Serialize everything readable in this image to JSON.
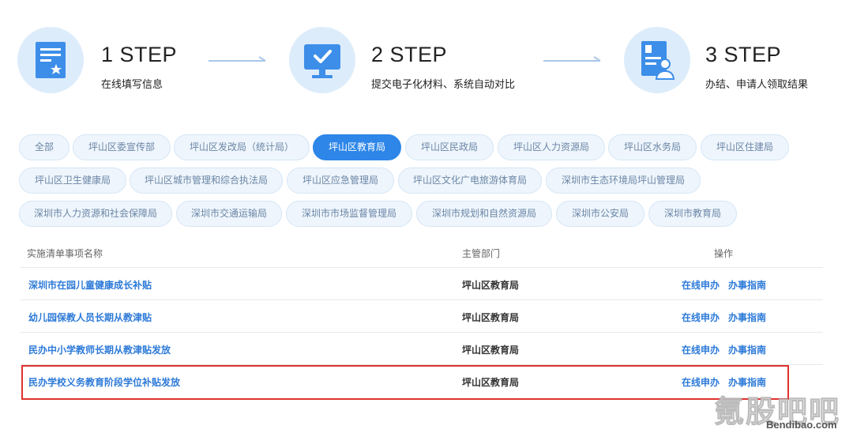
{
  "steps": [
    {
      "number": "1 STEP",
      "desc": "在线填写信息"
    },
    {
      "number": "2 STEP",
      "desc": "提交电子化材料、系统自动对比"
    },
    {
      "number": "3 STEP",
      "desc": "办结、申请人领取结果"
    }
  ],
  "tags": [
    {
      "label": "全部"
    },
    {
      "label": "坪山区委宣传部"
    },
    {
      "label": "坪山区发改局（统计局）"
    },
    {
      "label": "坪山区教育局"
    },
    {
      "label": "坪山区民政局"
    },
    {
      "label": "坪山区人力资源局"
    },
    {
      "label": "坪山区水务局"
    },
    {
      "label": "坪山区住建局"
    },
    {
      "label": "坪山区卫生健康局"
    },
    {
      "label": "坪山区城市管理和综合执法局"
    },
    {
      "label": "坪山区应急管理局"
    },
    {
      "label": "坪山区文化广电旅游体育局"
    },
    {
      "label": "深圳市生态环境局坪山管理局"
    },
    {
      "label": "深圳市人力资源和社会保障局"
    },
    {
      "label": "深圳市交通运输局"
    },
    {
      "label": "深圳市市场监督管理局"
    },
    {
      "label": "深圳市规划和自然资源局"
    },
    {
      "label": "深圳市公安局"
    },
    {
      "label": "深圳市教育局"
    }
  ],
  "table": {
    "headers": {
      "name": "实施清单事项名称",
      "dept": "主管部门",
      "ops": "操作"
    },
    "rows": [
      {
        "name": "深圳市在园儿童健康成长补贴",
        "dept": "坪山区教育局",
        "op1": "在线申办",
        "op2": "办事指南"
      },
      {
        "name": "幼儿园保教人员长期从教津贴",
        "dept": "坪山区教育局",
        "op1": "在线申办",
        "op2": "办事指南"
      },
      {
        "name": "民办中小学教师长期从教津贴发放",
        "dept": "坪山区教育局",
        "op1": "在线申办",
        "op2": "办事指南"
      },
      {
        "name": "民办学校义务教育阶段学位补贴发放",
        "dept": "坪山区教育局",
        "op1": "在线申办",
        "op2": "办事指南"
      }
    ]
  },
  "watermark": {
    "big": "氪股吧吧",
    "small": "Bendibao.com"
  },
  "colors": {
    "accent": "#2d86e8",
    "link": "#2d7ad8",
    "tag_bg": "#eef5fc",
    "highlight": "#e0322e"
  }
}
